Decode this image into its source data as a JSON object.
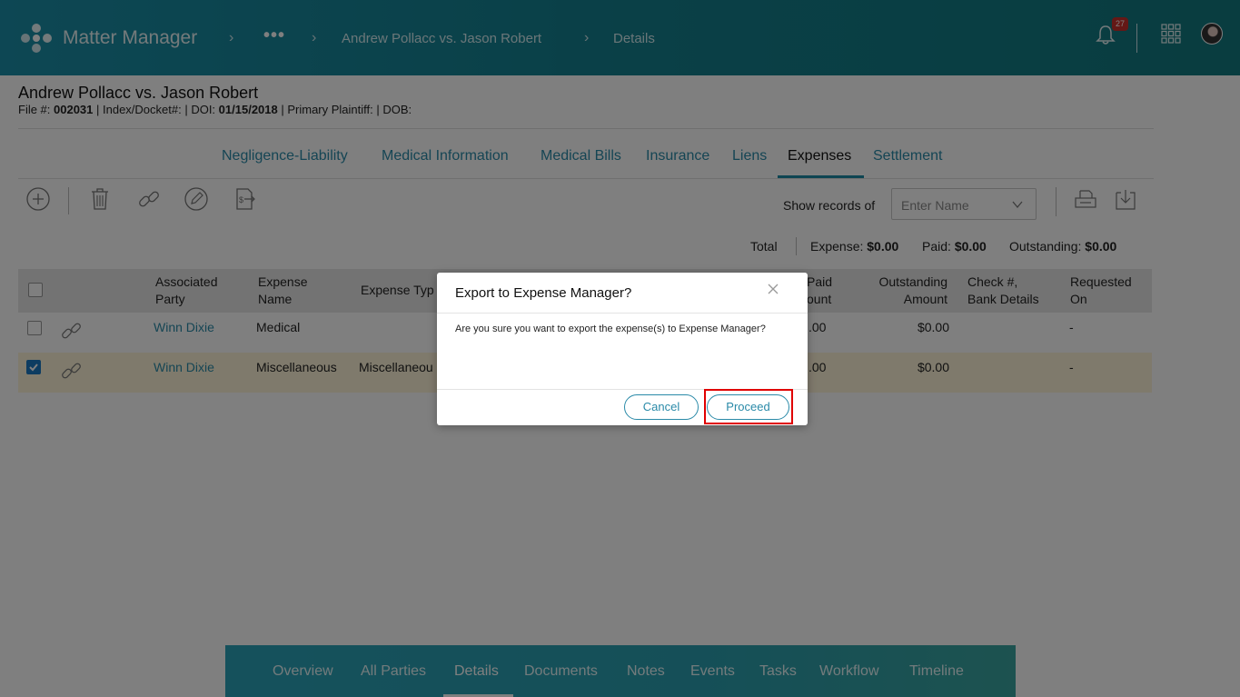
{
  "header": {
    "app_title": "Matter Manager",
    "breadcrumb_dots": "•••",
    "breadcrumb_matter": "Andrew Pollacc vs. Jason Robert",
    "breadcrumb_page": "Details",
    "notification_count": "27",
    "icons": [
      "matter-manager-logo-icon",
      "bell-icon",
      "apps-grid-icon",
      "user-avatar"
    ]
  },
  "matter": {
    "title": "Andrew Pollacc vs. Jason Robert",
    "file_label": "File #: ",
    "file_number": "002031",
    "meta_rest_1": " | Index/Docket#: | DOI: ",
    "doi": "01/15/2018",
    "meta_rest_2": " | Primary Plaintiff: | DOB:"
  },
  "tabs": [
    {
      "label": "Negligence-Liability",
      "active": false
    },
    {
      "label": "Medical Information",
      "active": false
    },
    {
      "label": "Medical Bills",
      "active": false
    },
    {
      "label": "Insurance",
      "active": false
    },
    {
      "label": "Liens",
      "active": false
    },
    {
      "label": "Expenses",
      "active": true
    },
    {
      "label": "Settlement",
      "active": false
    }
  ],
  "toolbar": {
    "icons": [
      "add-icon",
      "delete-icon",
      "link-icon",
      "edit-icon",
      "export-expense-icon",
      "print-icon",
      "download-icon"
    ],
    "show_records_label": "Show records of",
    "name_placeholder": "Enter Name"
  },
  "totals": {
    "total_label": "Total",
    "expense_label": "Expense: ",
    "expense_value": "$0.00",
    "paid_label": "Paid: ",
    "paid_value": "$0.00",
    "outstanding_label": "Outstanding: ",
    "outstanding_value": "$0.00"
  },
  "table": {
    "headers": {
      "associated_party": [
        "Associated",
        "Party"
      ],
      "expense_name": [
        "Expense",
        "Name"
      ],
      "expense_type": "Expense Typ",
      "paid_amount": [
        "Paid",
        "ount"
      ],
      "outstanding_amount": [
        "Outstanding",
        "Amount"
      ],
      "check_bank": [
        "Check #,",
        "Bank Details"
      ],
      "requested_on": [
        "Requested",
        "On"
      ]
    },
    "rows": [
      {
        "checked": false,
        "party": "Winn Dixie",
        "expense_name": "Medical",
        "expense_type": "",
        "paid": ".00",
        "outstanding": "$0.00",
        "requested": "-"
      },
      {
        "checked": true,
        "party": "Winn Dixie",
        "expense_name": "Miscellaneous",
        "expense_type": "Miscellaneou",
        "paid": ".00",
        "outstanding": "$0.00",
        "requested": "-"
      }
    ]
  },
  "bottom_nav": [
    {
      "label": "Overview",
      "active": false
    },
    {
      "label": "All Parties",
      "active": false
    },
    {
      "label": "Details",
      "active": true
    },
    {
      "label": "Documents",
      "active": false
    },
    {
      "label": "Notes",
      "active": false
    },
    {
      "label": "Events",
      "active": false
    },
    {
      "label": "Tasks",
      "active": false
    },
    {
      "label": "Workflow",
      "active": false
    },
    {
      "label": "Timeline",
      "active": false
    }
  ],
  "modal": {
    "title": "Export to Expense Manager?",
    "body": "Are you sure you want to export the expense(s) to Expense Manager?",
    "cancel_label": "Cancel",
    "proceed_label": "Proceed"
  },
  "colors": {
    "header_gradient_start": "#1b8fa8",
    "header_gradient_end": "#127a80",
    "link": "#2a8aa8",
    "selected_row": "#fff5d8",
    "checkbox_checked": "#1a78c2",
    "highlight_box": "#e00000"
  }
}
